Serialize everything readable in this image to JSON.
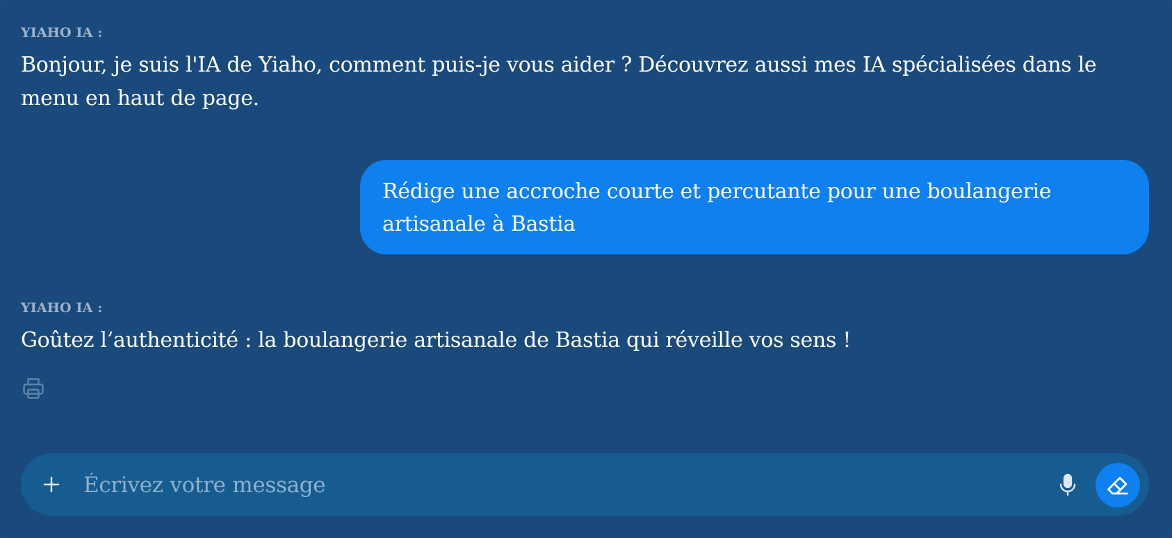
{
  "conversation": {
    "messages": [
      {
        "sender": "YIAHO IA :",
        "text": "Bonjour, je suis l'IA de Yiaho, comment puis-je vous aider ? Découvrez aussi mes IA spécialisées dans le menu en haut de page."
      },
      {
        "sender": "user",
        "text": "Rédige une accroche courte et percutante pour une boulangerie artisanale à Bastia"
      },
      {
        "sender": "YIAHO IA :",
        "text": "Goûtez l’authenticité : la boulangerie artisanale de Bastia qui réveille vos sens !"
      }
    ]
  },
  "actions": {
    "print_icon": "printer-icon"
  },
  "composer": {
    "placeholder": "Écrivez votre message",
    "value": "",
    "plus_icon": "plus-icon",
    "mic_icon": "microphone-icon",
    "erase_icon": "eraser-icon"
  },
  "colors": {
    "background": "#1a4a7c",
    "user_bubble": "#0f80f0",
    "input_bar": "#165c91",
    "bot_label": "#9fb3cc",
    "accent": "#0f80f0"
  }
}
